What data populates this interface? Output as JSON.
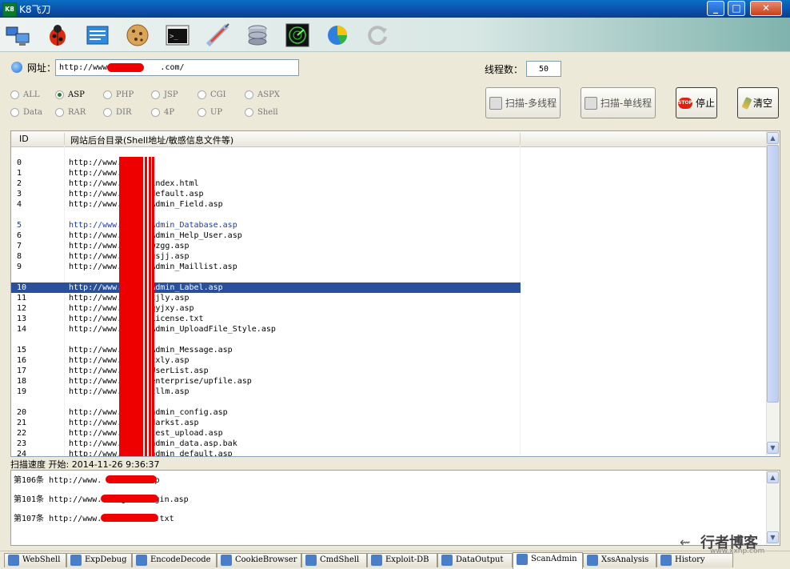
{
  "window": {
    "title": "K8飞刀",
    "icon_label": "K8",
    "controls": {
      "minimize": "_",
      "maximize": "□",
      "close": "✕"
    }
  },
  "toolbar": {
    "icons": [
      "network-icon",
      "bug-icon",
      "text-editor-icon",
      "cookie-icon",
      "terminal-icon",
      "syringe-icon",
      "database-icon",
      "radar-icon",
      "pie-chart-icon",
      "refresh-icon"
    ]
  },
  "form": {
    "url_label": "网址：",
    "url_value": "http://www.          .com/",
    "threads_label": "线程数：",
    "threads_value": "50"
  },
  "radios": [
    {
      "label": "ALL",
      "checked": false
    },
    {
      "label": "ASP",
      "checked": true
    },
    {
      "label": "PHP",
      "checked": false
    },
    {
      "label": "JSP",
      "checked": false
    },
    {
      "label": "CGI",
      "checked": false
    },
    {
      "label": "ASPX",
      "checked": false
    },
    {
      "label": "Data",
      "checked": false
    },
    {
      "label": "RAR",
      "checked": false
    },
    {
      "label": "DIR",
      "checked": false
    },
    {
      "label": "4P",
      "checked": false
    },
    {
      "label": "UP",
      "checked": false
    },
    {
      "label": "Shell",
      "checked": false
    }
  ],
  "buttons": {
    "scan_multi": "扫描-多线程",
    "scan_single": "扫描-单线程",
    "stop": "停止",
    "clear": "清空",
    "stop_badge": "STOP"
  },
  "table": {
    "columns": [
      "ID",
      "网站后台目录(Shell地址/敏感信息文件等)"
    ],
    "rows": [
      {
        "id": "",
        "path": ""
      },
      {
        "id": "0",
        "path": "http://www.        .com/"
      },
      {
        "id": "1",
        "path": "http://www.        .com/"
      },
      {
        "id": "2",
        "path": "http://www.        .com/index.html"
      },
      {
        "id": "3",
        "path": "http://www.        .com/default.asp"
      },
      {
        "id": "4",
        "path": "http://www.        .com/Admin_Field.asp"
      },
      {
        "id": "",
        "path": ""
      },
      {
        "id": "5",
        "path": "http://www.        .com/Admin_Database.asp"
      },
      {
        "id": "6",
        "path": "http://www.        .com/Admin_Help_User.asp"
      },
      {
        "id": "7",
        "path": "http://www.        .com/wzgg.asp"
      },
      {
        "id": "8",
        "path": "http://www.        .com/gsjj.asp"
      },
      {
        "id": "9",
        "path": "http://www.        .com/Admin_Maillist.asp"
      },
      {
        "id": "",
        "path": ""
      },
      {
        "id": "10",
        "path": "http://www.        .com/Admin_Label.asp"
      },
      {
        "id": "11",
        "path": "http://www.        .com/tjly.asp"
      },
      {
        "id": "12",
        "path": "http://www.        .com/qyjxy.asp"
      },
      {
        "id": "13",
        "path": "http://www.        .com/License.txt"
      },
      {
        "id": "14",
        "path": "http://www.        .com/Admin_UploadFile_Style.asp"
      },
      {
        "id": "",
        "path": ""
      },
      {
        "id": "15",
        "path": "http://www.        .com/Admin_Message.asp"
      },
      {
        "id": "16",
        "path": "http://www.        .com/zxly.asp"
      },
      {
        "id": "17",
        "path": "http://www.        .com/UserList.asp"
      },
      {
        "id": "18",
        "path": "http://www.        .com/enterprise/upfile.asp"
      },
      {
        "id": "19",
        "path": "http://www.        .com/zllm.asp"
      },
      {
        "id": "",
        "path": ""
      },
      {
        "id": "20",
        "path": "http://www.        .com/admin_config.asp"
      },
      {
        "id": "21",
        "path": "http://www.        .com/darkst.asp"
      },
      {
        "id": "22",
        "path": "http://www.        .com/test_upload.asp"
      },
      {
        "id": "23",
        "path": "http://www.        .com/admin_data.asp.bak"
      },
      {
        "id": "24",
        "path": "http://www.        .com/admin_default.asp"
      }
    ],
    "selected_id": "10"
  },
  "status": {
    "label": "扫描速度  开始: 2014-11-26 9:36:37"
  },
  "log": [
    "第106条 http://www.          m/count.asp",
    "第101条 http://www.          om/guli/login.asp",
    "第107条 http://www.          om/bdunion.txt"
  ],
  "tabs": [
    {
      "label": "WebShell",
      "icon": "webshell-icon",
      "active": false
    },
    {
      "label": "ExpDebug",
      "icon": "bug-icon",
      "active": false
    },
    {
      "label": "EncodeDecode",
      "icon": "encode-icon",
      "active": false
    },
    {
      "label": "CookieBrowser",
      "icon": "cookie-icon",
      "active": false
    },
    {
      "label": "CmdShell",
      "icon": "terminal-icon",
      "active": false
    },
    {
      "label": "Exploit-DB",
      "icon": "exploit-icon",
      "active": false
    },
    {
      "label": "DataOutput",
      "icon": "database-icon",
      "active": false
    },
    {
      "label": "ScanAdmin",
      "icon": "radar-icon",
      "active": true
    },
    {
      "label": "XssAnalysis",
      "icon": "pie-chart-icon",
      "active": false
    },
    {
      "label": "History",
      "icon": "history-icon",
      "active": false
    }
  ],
  "watermark": {
    "text": "行者博客",
    "url": "www.xxhp.com"
  },
  "colors": {
    "selection": "#2a4f9b",
    "titlebar": "#0b4fa8",
    "redaction": "#e00000"
  }
}
